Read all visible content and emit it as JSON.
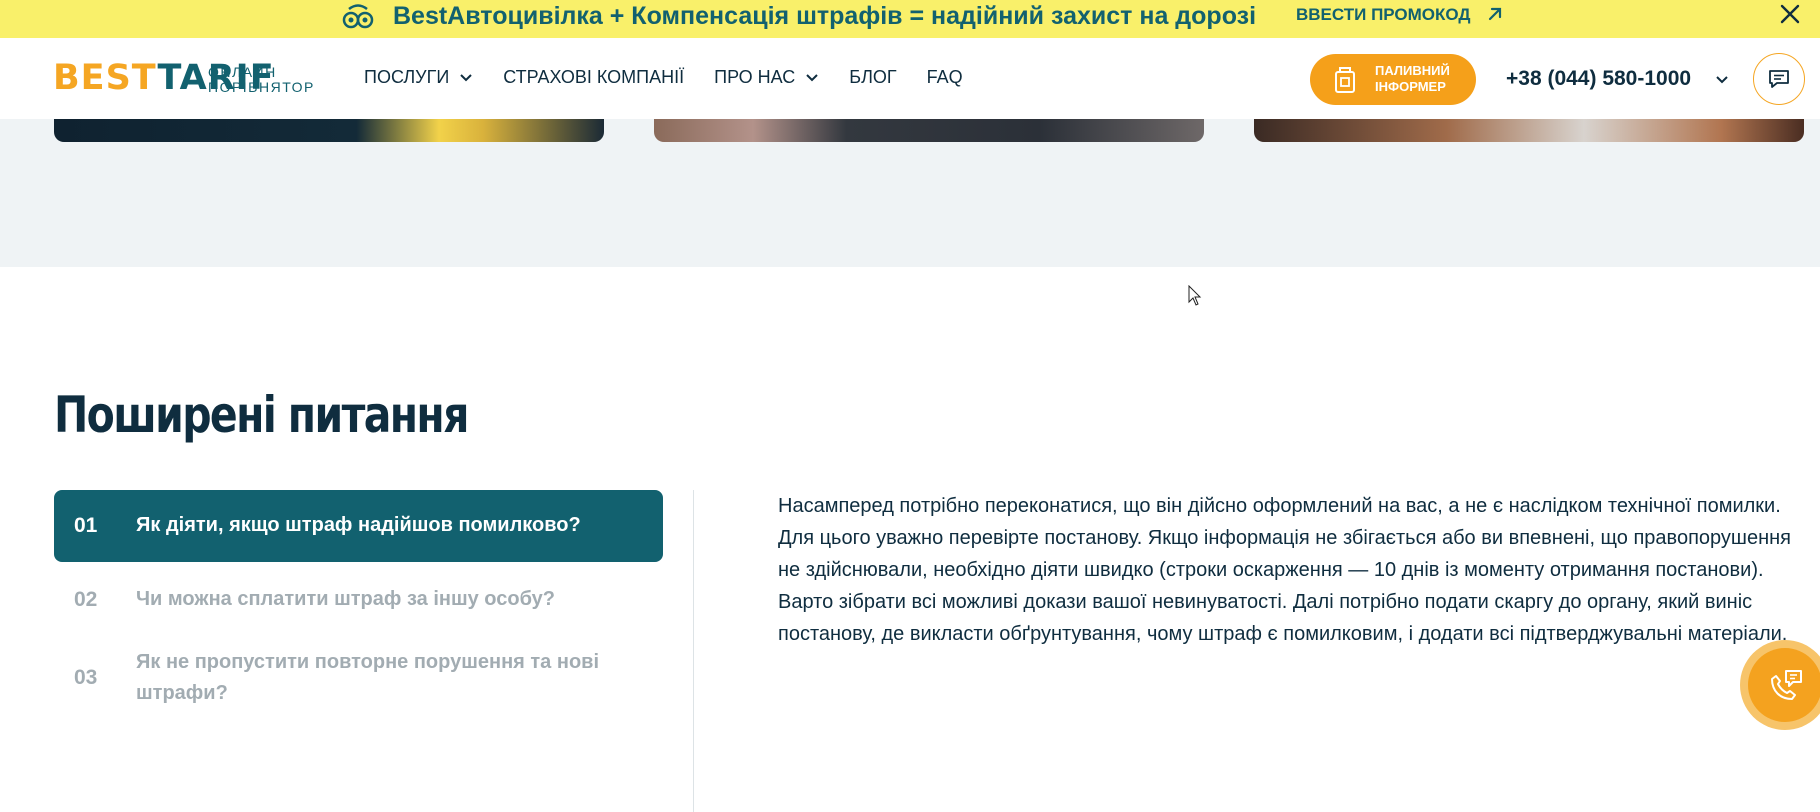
{
  "promo": {
    "text": "BestАвтоцивілка + Компенсація штрафів = надійний захист на дорозі",
    "link_label": "ВВЕСТИ ПРОМОКОД",
    "icon": "glasses-mascot-icon"
  },
  "header": {
    "logo_best": "BEST",
    "logo_tarif": "TARIF",
    "logo_sub_1": "ОНЛАЙН",
    "logo_sub_2": "ПОРІВНЯТОР",
    "nav": [
      {
        "label": "ПОСЛУГИ",
        "has_dropdown": true
      },
      {
        "label": "СТРАХОВІ КОМПАНІЇ",
        "has_dropdown": false
      },
      {
        "label": "ПРО НАС",
        "has_dropdown": true
      },
      {
        "label": "БЛОГ",
        "has_dropdown": false
      },
      {
        "label": "FAQ",
        "has_dropdown": false
      }
    ],
    "fuel_label_1": "ПАЛИВНИЙ",
    "fuel_label_2": "ІНФОРМЕР",
    "phone": "+38 (044) 580-1000"
  },
  "faq": {
    "title": "Поширені питання",
    "items": [
      {
        "num": "01",
        "question": "Як діяти, якщо штраф надійшов помилково?",
        "active": true
      },
      {
        "num": "02",
        "question": "Чи можна сплатити штраф за іншу особу?",
        "active": false
      },
      {
        "num": "03",
        "question": "Як не пропустити повторне порушення та нові штрафи?",
        "active": false
      }
    ],
    "answer": "Насамперед потрібно переконатися, що він дійсно оформлений на вас, а не є наслідком технічної помилки. Для цього уважно перевірте постанову. Якщо інформація не збігається або ви впевнені, що правопорушення не здійснювали, необхідно діяти швидко (строки оскарження — 10 днів із моменту отримання постанови). Варто зібрати всі можливі докази вашої невинуватості. Далі потрібно подати скаргу до органу, який виніс постанову, де викласти обґрунтування, чому штраф є помилковим, і додати всі підтверджувальні матеріали."
  },
  "colors": {
    "banner": "#f9f06a",
    "brand_teal": "#12616f",
    "brand_orange": "#f5a01a",
    "text_dark": "#0f2d3f",
    "muted": "#a2acb2"
  }
}
